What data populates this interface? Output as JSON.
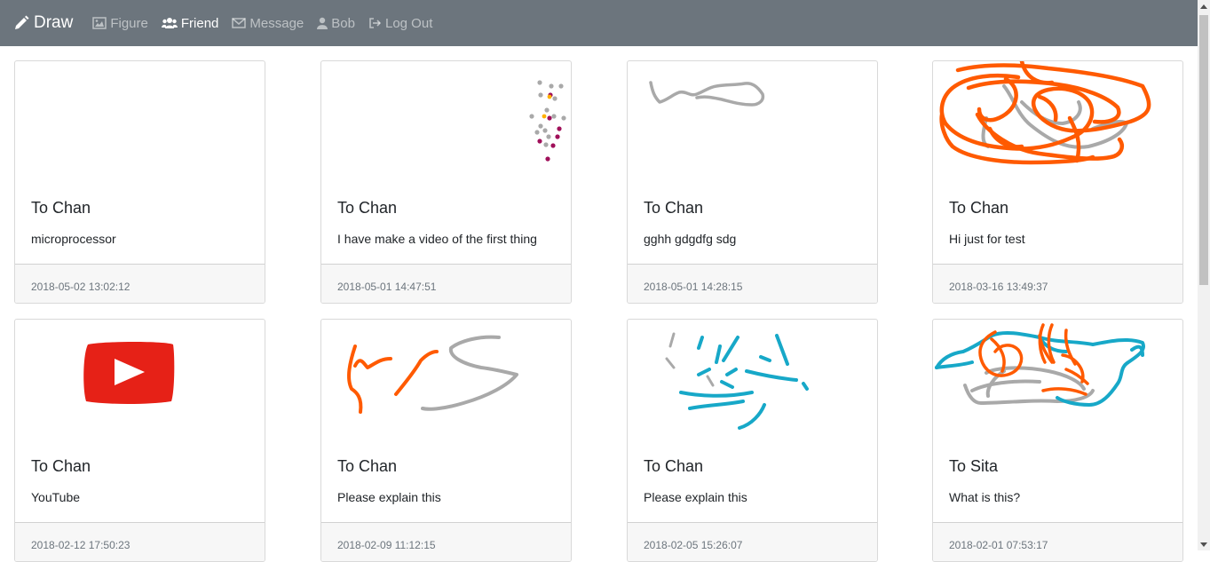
{
  "nav": {
    "brand": "Draw",
    "items": [
      {
        "label": "Figure",
        "icon": "image-icon",
        "active": false
      },
      {
        "label": "Friend",
        "icon": "users-icon",
        "active": true
      },
      {
        "label": "Message",
        "icon": "envelope-icon",
        "active": false
      },
      {
        "label": "Bob",
        "icon": "user-icon",
        "active": false
      },
      {
        "label": "Log Out",
        "icon": "sign-out-icon",
        "active": false
      }
    ],
    "background": "#6c757d"
  },
  "cards": [
    {
      "title": "To Chan",
      "text": "microprocessor",
      "date": "2018-05-02 13:02:12",
      "drawing": "blank"
    },
    {
      "title": "To Chan",
      "text": "I have make a video of the first thing",
      "date": "2018-05-01 14:47:51",
      "drawing": "dots"
    },
    {
      "title": "To Chan",
      "text": "gghh gdgdfg sdg",
      "date": "2018-05-01 14:28:15",
      "drawing": "grey-scribble"
    },
    {
      "title": "To Chan",
      "text": "Hi just for test",
      "date": "2018-03-16 13:49:37",
      "drawing": "orange-scribble"
    },
    {
      "title": "To Chan",
      "text": "YouTube",
      "date": "2018-02-12 17:50:23",
      "drawing": "youtube-logo"
    },
    {
      "title": "To Chan",
      "text": "Please explain this",
      "date": "2018-02-09 11:12:15",
      "drawing": "orange-grey-strokes"
    },
    {
      "title": "To Chan",
      "text": "Please explain this",
      "date": "2018-02-05 15:26:07",
      "drawing": "teal-strokes"
    },
    {
      "title": "To Sita",
      "text": "What is this?",
      "date": "2018-02-01 07:53:17",
      "drawing": "teal-orange-scribble"
    }
  ],
  "colors": {
    "stroke_orange": "#ff5a00",
    "stroke_grey": "#a9a9a9",
    "stroke_teal": "#17a8c8",
    "dot_magenta": "#a0105a",
    "dot_yellow": "#ffb000",
    "youtube_red": "#e62117"
  }
}
